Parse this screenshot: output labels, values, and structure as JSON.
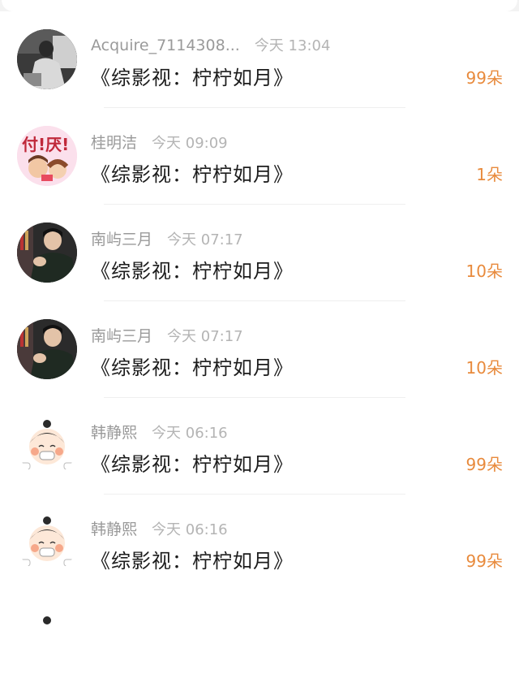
{
  "gifts": [
    {
      "username": "Acquire_7114308...",
      "time": "今天 13:04",
      "title": "《综影视：柠柠如月》",
      "count": "99朵",
      "avatar": "dark-photo-avatar"
    },
    {
      "username": "桂明洁",
      "time": "今天 09:09",
      "title": "《综影视：柠柠如月》",
      "count": "1朵",
      "avatar": "pink-cartoon-avatar"
    },
    {
      "username": "南屿三月",
      "time": "今天 07:17",
      "title": "《综影视：柠柠如月》",
      "count": "10朵",
      "avatar": "man-photo-avatar"
    },
    {
      "username": "南屿三月",
      "time": "今天 07:17",
      "title": "《综影视：柠柠如月》",
      "count": "10朵",
      "avatar": "man-photo-avatar"
    },
    {
      "username": "韩静熙",
      "time": "今天 06:16",
      "title": "《综影视：柠柠如月》",
      "count": "99朵",
      "avatar": "cartoon-girl-avatar"
    },
    {
      "username": "韩静熙",
      "time": "今天 06:16",
      "title": "《综影视：柠柠如月》",
      "count": "99朵",
      "avatar": "cartoon-girl-avatar"
    }
  ],
  "colors": {
    "count": "#e88a3c",
    "name": "#9a9a9a",
    "time": "#b4b4b4",
    "title": "#1c1c1c"
  }
}
